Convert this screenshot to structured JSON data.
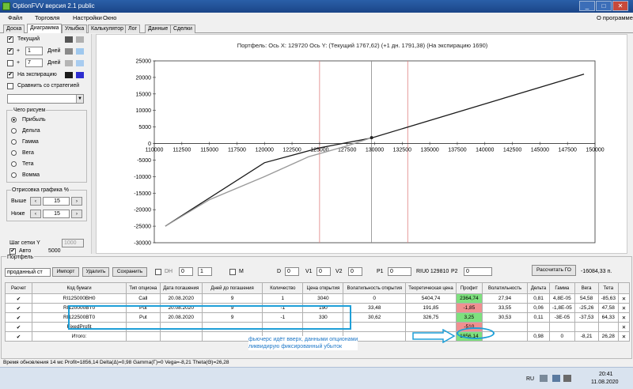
{
  "window": {
    "title": "OptionFVV версия 2.1 public",
    "controls": [
      "_",
      "□",
      "✕"
    ]
  },
  "menu": {
    "items": [
      "Файл",
      "Торговля",
      "Настройки",
      "Окно"
    ],
    "about": "О программе"
  },
  "tabs": [
    "Доска",
    "Диаграмма",
    "Улыбка",
    "Калькулятор",
    "Лог",
    "Данные",
    "Сделки"
  ],
  "left": {
    "current": {
      "label": "Текущий",
      "checked": true,
      "colors": [
        "#555555",
        "#b0b0b0"
      ]
    },
    "plus1": {
      "checked": true,
      "sign": "+",
      "value": "1",
      "unit": "Дней",
      "colors": [
        "#8a8a8a",
        "#9fc8ee"
      ]
    },
    "plus7": {
      "checked": false,
      "sign": "+",
      "value": "7",
      "unit": "Дней",
      "colors": [
        "#b5b5b5",
        "#a8ccf0"
      ]
    },
    "expiry": {
      "label": "На экспирацию",
      "checked": true,
      "colors": [
        "#1a1a1a",
        "#2d2dd0"
      ]
    },
    "compare": {
      "label": "Сравнить со стратегией",
      "checked": false
    },
    "draw_group": "Чего рисуем",
    "radios": [
      "Прибыль",
      "Дельта",
      "Гамма",
      "Вега",
      "Тета",
      "Вомма"
    ],
    "selected_radio": "Прибыль",
    "render_group": "Отрисовка графика %",
    "above_label": "Выше",
    "above_value": "15",
    "below_label": "Ниже",
    "below_value": "15",
    "grid_label": "Шаг сетки Y",
    "grid_value": "1000",
    "auto_label": "Авто",
    "auto_value": "5000"
  },
  "chart_data": {
    "type": "line",
    "title": "Портфель:  Ось X:  129720 Ось Y:  (Текущий 1767,62)  (+1 дн. 1791,38)  (На экспирацию 1690)",
    "xlim": [
      110000,
      150000
    ],
    "ylim": [
      -30000,
      25000
    ],
    "xticks": [
      110000,
      112500,
      115000,
      117500,
      120000,
      122500,
      125000,
      127500,
      130000,
      132500,
      135000,
      137500,
      140000,
      142500,
      145000,
      147500,
      150000
    ],
    "yticks": [
      25000,
      20000,
      15000,
      10000,
      5000,
      0,
      -5000,
      -10000,
      -15000,
      -20000,
      -25000,
      -30000
    ],
    "vlines": [
      {
        "x": 125000,
        "color": "#e08080"
      },
      {
        "x": 129720,
        "color": "#888888"
      },
      {
        "x": 133000,
        "color": "#e08080"
      }
    ],
    "marker": {
      "x": 129720,
      "y": 1767
    },
    "series": [
      {
        "color": "#1a1a1a",
        "x": [
          111000,
          120000,
          125000,
          129720,
          149000
        ],
        "y": [
          -25000,
          -5800,
          -1300,
          1690,
          21000
        ]
      },
      {
        "color": "#999999",
        "x": [
          111000,
          115000,
          120000,
          124000,
          127500,
          129720
        ],
        "y": [
          -25000,
          -17000,
          -10000,
          -4000,
          -700,
          1767
        ]
      }
    ]
  },
  "portfolio": {
    "group": "Портфель",
    "select": "проданный ст",
    "buttons": [
      "Импорт",
      "Удалить",
      "Сохранить"
    ],
    "dh": "DH",
    "dh_val": "0",
    "dh_val2": "1",
    "m": "M",
    "d": "D",
    "d_val": "0",
    "v1": "V1",
    "v1_val": "0",
    "v2": "V2",
    "v2_val": "0",
    "p1": "P1",
    "p1_val": "0",
    "riu": "RIU0 129810",
    "p2": "P2",
    "p2_val": "0",
    "calc_btn": "Рассчитать ГО",
    "go_val": "-16084,33 п.",
    "headers": [
      "Расчет",
      "Код бумаги",
      "Тип опциона",
      "Дата погашения",
      "Дней до погашения",
      "Количество",
      "Цена открытия",
      "Волатильность открытия",
      "Теоретическая цена",
      "Профит",
      "Волатильность",
      "Дельта",
      "Гамма",
      "Вега",
      "Тета",
      ""
    ],
    "rows": [
      {
        "check": "✔",
        "code": "RI125000BH0",
        "type": "Call",
        "date": "20.08.2020",
        "days": "9",
        "qty": "1",
        "price": "3040",
        "vol_open": "0",
        "theo": "5404,74",
        "profit": "2364,74",
        "vol": "27,94",
        "delta": "0,81",
        "gamma": "4,8E-05",
        "vega": "54,58",
        "theta": "-85,63",
        "x": "✕",
        "pcolor": "#7ee07e"
      },
      {
        "check": "✔",
        "code": "RI120000BT0",
        "type": "Put",
        "date": "20.08.2020",
        "days": "9",
        "qty": "-1",
        "price": "190",
        "vol_open": "33,48",
        "theo": "191,85",
        "profit": "-1,85",
        "vol": "33,55",
        "delta": "0,06",
        "gamma": "-1,8E-05",
        "vega": "-25,26",
        "theta": "47,58",
        "x": "✕",
        "pcolor": "#f09090"
      },
      {
        "check": "✔",
        "code": "RI122500BT0",
        "type": "Put",
        "date": "20.08.2020",
        "days": "9",
        "qty": "-1",
        "price": "330",
        "vol_open": "30,62",
        "theo": "326,75",
        "profit": "3,25",
        "vol": "30,53",
        "delta": "0,11",
        "gamma": "-3E-05",
        "vega": "-37,53",
        "theta": "64,33",
        "x": "✕",
        "pcolor": "#7ee07e"
      },
      {
        "check": "✔",
        "code": "FixedProfit",
        "type": "",
        "date": "",
        "days": "",
        "qty": "",
        "price": "",
        "vol_open": "",
        "theo": "",
        "profit": "-510",
        "vol": "",
        "delta": "",
        "gamma": "",
        "vega": "",
        "theta": "",
        "x": "✕",
        "pcolor": "#f09090"
      },
      {
        "check": "✔",
        "code": "Итого:",
        "type": "",
        "date": "",
        "days": "",
        "qty": "",
        "price": "",
        "vol_open": "",
        "theo": "",
        "profit": "1856,14",
        "vol": "",
        "delta": "0,98",
        "gamma": "0",
        "vega": "-8,21",
        "theta": "26,28",
        "x": "✕",
        "pcolor": "#7ee07e"
      }
    ]
  },
  "annotation": {
    "line1": "фьючерс идёт вверх, данными опционами",
    "line2": "ликвидирую фиксированный убыток"
  },
  "status": "Время обновления 14 мс  Profit=1856,14 Delta(Δ)=0,98 Gamma(Γ)=0 Vega=-8,21 Theta(Θ)=26,28",
  "taskbar": {
    "lang": "RU",
    "time": "20:41",
    "date": "11.08.2020"
  }
}
